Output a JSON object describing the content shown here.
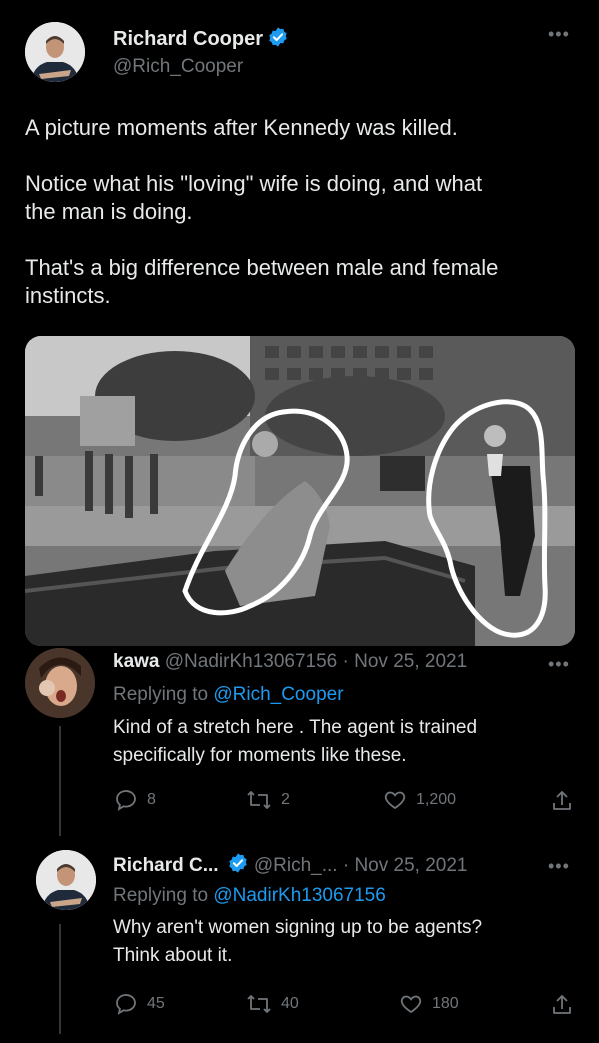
{
  "main_tweet": {
    "author_name": "Richard Cooper",
    "author_handle": "@Rich_Cooper",
    "text_lines": [
      "A picture moments after Kennedy was killed.",
      "Notice what his \"loving\" wife is doing, and what",
      "the man is doing.",
      "That's a big difference between male and female",
      "instincts."
    ]
  },
  "reply1": {
    "name": "kawa",
    "handle": "@NadirKh13067156",
    "separator": "·",
    "date": "Nov 25, 2021",
    "replying_prefix": "Replying to",
    "replying_to": "@Rich_Cooper",
    "text_lines": [
      "Kind of a stretch here . The agent is trained",
      "specifically for moments like these."
    ],
    "replies": "8",
    "retweets": "2",
    "likes": "1,200"
  },
  "reply2": {
    "name": "Richard C...",
    "handle": "@Rich_...",
    "separator": "·",
    "date": "Nov 25, 2021",
    "replying_prefix": "Replying to",
    "replying_to": "@NadirKh13067156",
    "text_lines": [
      "Why aren't women signing up to be agents?",
      "Think about it."
    ],
    "replies": "45",
    "retweets": "40",
    "likes": "180"
  },
  "colors": {
    "background": "#000000",
    "text": "#e7e9ea",
    "muted": "#71767b",
    "link": "#1d9bf0"
  }
}
